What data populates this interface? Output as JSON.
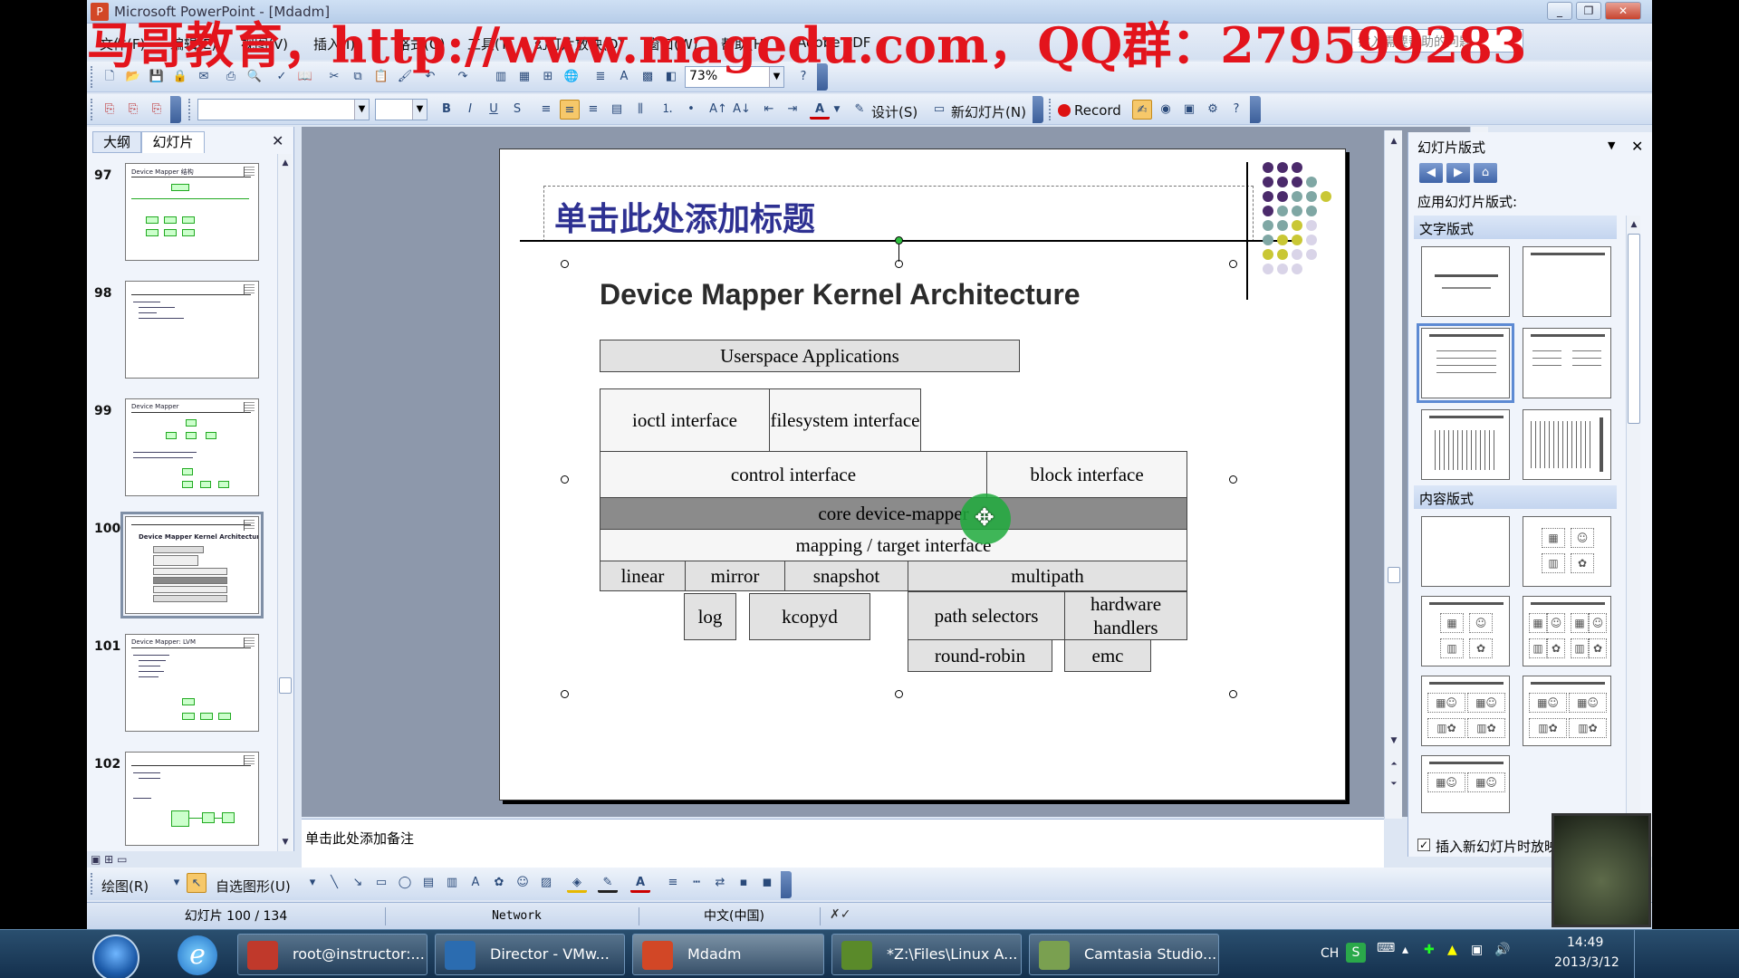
{
  "window": {
    "title": "Microsoft PowerPoint - [Mdadm]",
    "controls": [
      "_",
      "❐",
      "✕"
    ]
  },
  "watermark": "马哥教育，http://www.magedu.com，QQ群：279599283",
  "menu": {
    "items": [
      "文件(F)",
      "编辑(E)",
      "视图(V)",
      "插入(I)",
      "格式(O)",
      "工具(T)",
      "幻灯片放映(D)",
      "窗口(W)",
      "帮助(H)",
      "Adobe PDF"
    ],
    "help_search_placeholder": "键入需要帮助的问题"
  },
  "toolbar_standard": {
    "zoom": "73%"
  },
  "toolbar_format": {
    "font_name": "",
    "font_size": "",
    "design_label": "设计(S)",
    "new_slide_label": "新幻灯片(N)",
    "record_label": "Record"
  },
  "left_panel": {
    "tabs": [
      "大纲",
      "幻灯片"
    ],
    "active_tab": "幻灯片",
    "thumbnails": [
      {
        "number": "97",
        "title": "Device Mapper 结构"
      },
      {
        "number": "98",
        "title": ""
      },
      {
        "number": "99",
        "title": "Device Mapper"
      },
      {
        "number": "100",
        "title": "Device Mapper Kernel Architecture"
      },
      {
        "number": "101",
        "title": "Device Mapper: LVM"
      },
      {
        "number": "102",
        "title": ""
      }
    ],
    "selected": "100"
  },
  "slide": {
    "title_placeholder": "单击此处添加标题",
    "heading": "Device Mapper Kernel Architecture",
    "diagram": {
      "userspace": "Userspace Applications",
      "ioctl": "ioctl interface",
      "filesystem": "filesystem interface",
      "control": "control interface",
      "block": "block interface",
      "core": "core device-mapper",
      "mapping": "mapping / target interface",
      "linear": "linear",
      "mirror": "mirror",
      "snapshot": "snapshot",
      "multipath": "multipath",
      "log": "log",
      "kcopyd": "kcopyd",
      "path_selectors": "path selectors",
      "hardware_handlers": "hardware handlers",
      "round_robin": "round-robin",
      "emc": "emc"
    },
    "dot_colors": {
      "purple": "#4b2a6b",
      "teal": "#7fa7a4",
      "yellow": "#c9c735",
      "lavender": "#d9d4e8"
    }
  },
  "notes": {
    "placeholder": "单击此处添加备注"
  },
  "task_pane": {
    "title": "幻灯片版式",
    "apply_label": "应用幻灯片版式:",
    "section_text": "文字版式",
    "section_content": "内容版式",
    "insert_checkbox": "插入新幻灯片时放映",
    "insert_checked": true
  },
  "drawing_toolbar": {
    "draw_label": "绘图(R)",
    "autoshapes_label": "自选图形(U)"
  },
  "status": {
    "slide_info": "幻灯片 100 / 134",
    "design": "Network",
    "language": "中文(中国)"
  },
  "taskbar": {
    "items": [
      {
        "label": "root@instructor:...",
        "color": "#c0392b"
      },
      {
        "label": "Director - VMw...",
        "color": "#2b6cb0"
      },
      {
        "label": "Mdadm",
        "color": "#d24726"
      },
      {
        "label": "*Z:\\Files\\Linux A...",
        "color": "#5a8a2a"
      },
      {
        "label": "Camtasia Studio...",
        "color": "#7aa050"
      }
    ],
    "ime": "CH",
    "time": "14:49",
    "date": "2013/3/12"
  }
}
